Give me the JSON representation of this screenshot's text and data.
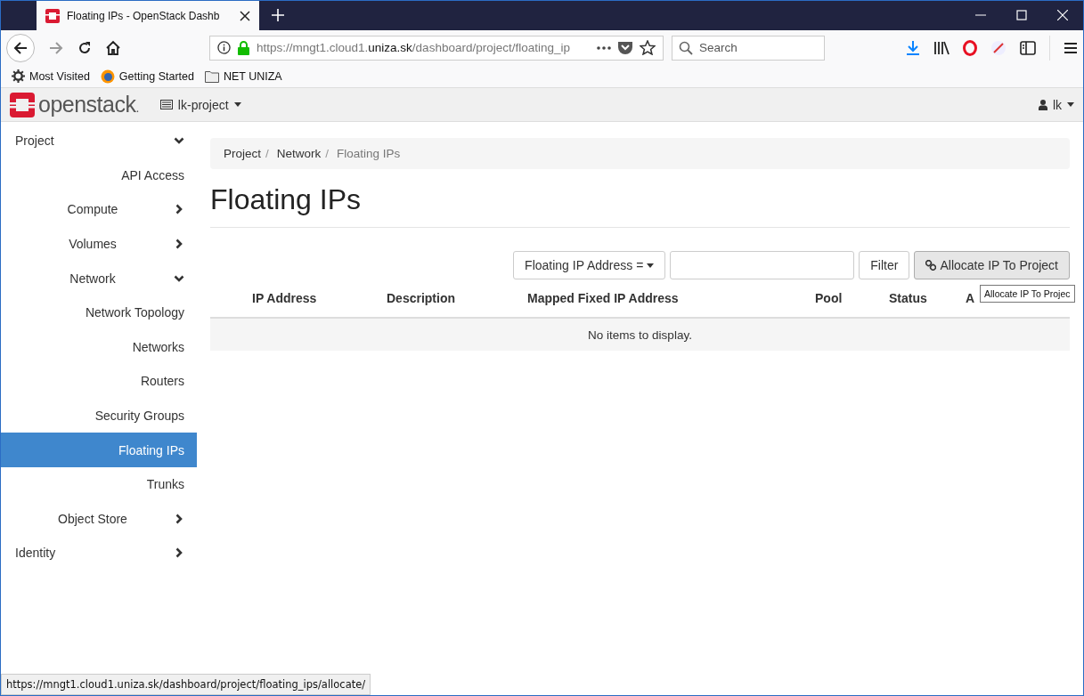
{
  "browser": {
    "tabs": [
      {
        "title": "Floating IPs - OpenStack Dashb",
        "selected": true
      }
    ],
    "url": {
      "prefix": "https://mngt1.cloud1.",
      "domain": "uniza.sk",
      "path": "/dashboard/project/floating_ip"
    },
    "search": {
      "placeholder": "Search"
    },
    "bookmarks": [
      {
        "kind": "gear",
        "label": "Most Visited"
      },
      {
        "kind": "firefox",
        "label": "Getting Started"
      },
      {
        "kind": "folder",
        "label": "NET UNIZA"
      }
    ],
    "status_url": "https://mngt1.cloud1.uniza.sk/dashboard/project/floating_ips/allocate/"
  },
  "header": {
    "logo": "openstack",
    "logo_dot": ".",
    "project": "lk-project",
    "user": "lk"
  },
  "sidebar": [
    {
      "kind": "group",
      "label": "Project",
      "expanded": true,
      "children": [
        {
          "kind": "link",
          "label": "API Access",
          "selected": false
        },
        {
          "kind": "group",
          "label": "Compute",
          "expanded": false
        },
        {
          "kind": "group",
          "label": "Volumes",
          "expanded": false
        },
        {
          "kind": "group",
          "label": "Network",
          "expanded": true,
          "children": [
            {
              "kind": "link",
              "label": "Network Topology",
              "selected": false
            },
            {
              "kind": "link",
              "label": "Networks",
              "selected": false
            },
            {
              "kind": "link",
              "label": "Routers",
              "selected": false
            },
            {
              "kind": "link",
              "label": "Security Groups",
              "selected": false
            },
            {
              "kind": "link",
              "label": "Floating IPs",
              "selected": true
            },
            {
              "kind": "link",
              "label": "Trunks",
              "selected": false
            }
          ]
        },
        {
          "kind": "group",
          "label": "Object Store",
          "expanded": false
        }
      ]
    },
    {
      "kind": "group",
      "label": "Identity",
      "expanded": false
    }
  ],
  "breadcrumb": [
    "Project",
    "Network",
    "Floating IPs"
  ],
  "breadcrumb_separator": "/",
  "page_title": "Floating IPs",
  "filter": {
    "field": "Floating IP Address =",
    "button": "Filter"
  },
  "action": "Allocate IP To Project",
  "tooltip": "Allocate IP To Projec",
  "table": {
    "columns": [
      "IP Address",
      "Description",
      "Mapped Fixed IP Address",
      "Pool",
      "Status",
      "A"
    ],
    "empty": "No items to display."
  }
}
